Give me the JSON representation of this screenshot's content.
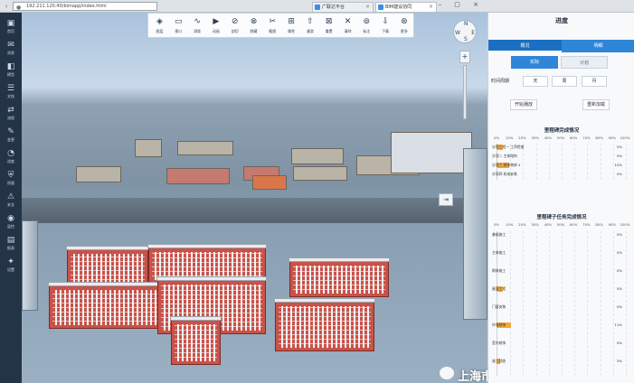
{
  "browser": {
    "address": "192.211.120.40/bimapp/index.html",
    "tabs": [
      {
        "label": "广联达平台"
      },
      {
        "label": "BIM建设协同"
      }
    ]
  },
  "sidebar": {
    "items": [
      {
        "icon": "▣",
        "label": "首页"
      },
      {
        "icon": "✉",
        "label": "消息"
      },
      {
        "icon": "◧",
        "label": "模型"
      },
      {
        "icon": "☰",
        "label": "文档"
      },
      {
        "icon": "⇄",
        "label": "流程"
      },
      {
        "icon": "✎",
        "label": "变更"
      },
      {
        "icon": "◔",
        "label": "进度"
      },
      {
        "icon": "⛨",
        "label": "质量"
      },
      {
        "icon": "⚠",
        "label": "安全"
      },
      {
        "icon": "◉",
        "label": "监控"
      },
      {
        "icon": "▤",
        "label": "报表"
      },
      {
        "icon": "✦",
        "label": "设置"
      }
    ]
  },
  "toolbar": {
    "tools": [
      {
        "icon": "◈",
        "label": "图层"
      },
      {
        "icon": "▭",
        "label": "视口"
      },
      {
        "icon": "∿",
        "label": "测距"
      },
      {
        "icon": "▶",
        "label": "动画"
      },
      {
        "icon": "⊘",
        "label": "剖切"
      },
      {
        "icon": "⊗",
        "label": "隐藏"
      },
      {
        "icon": "✂",
        "label": "截图"
      },
      {
        "icon": "⊞",
        "label": "属性"
      },
      {
        "icon": "⇧",
        "label": "漫游"
      },
      {
        "icon": "⊠",
        "label": "重置"
      },
      {
        "icon": "✕",
        "label": "清除"
      },
      {
        "icon": "⊚",
        "label": "标注"
      },
      {
        "icon": "⇩",
        "label": "下载"
      },
      {
        "icon": "⊛",
        "label": "更多"
      }
    ]
  },
  "viewer": {
    "compass": {
      "n": "N",
      "e": "E",
      "s": "S",
      "w": "W"
    },
    "zoom_in": "+",
    "collapse": "⇥"
  },
  "panel": {
    "title": "进度",
    "tabs": [
      {
        "label": "概况"
      },
      {
        "label": "明细"
      }
    ],
    "toggle_actual": "实际",
    "toggle_plan": "计划",
    "period_label": "时间周期",
    "periods": [
      "天",
      "周",
      "月"
    ],
    "actions": [
      "开始播放",
      "重新加载"
    ],
    "section1_title": "里程碑完成情况",
    "section2_title": "里程碑子任务完成情况",
    "axis_ticks": [
      "0%",
      "10%",
      "20%",
      "30%",
      "40%",
      "50%",
      "60%",
      "70%",
      "80%",
      "90%",
      "100%"
    ],
    "milestones": [
      {
        "label": "分项工程一 工序检查",
        "value": 5,
        "value_text": "5%"
      },
      {
        "label": "分项二 主体结构",
        "value": 0,
        "value_text": "0%"
      },
      {
        "label": "分项三 装饰装修 4",
        "value": 10,
        "value_text": "10%"
      },
      {
        "label": "分项四 机电安装",
        "value": 0,
        "value_text": "0%"
      }
    ],
    "subtasks": [
      {
        "label": "基础施工",
        "value": 0,
        "value_text": "0%"
      },
      {
        "label": "主体施工",
        "value": 0,
        "value_text": "0%"
      },
      {
        "label": "砌体施工",
        "value": 0,
        "value_text": "0%"
      },
      {
        "label": "屋面工程",
        "value": 5,
        "value_text": "5%"
      },
      {
        "label": "门窗安装",
        "value": 0,
        "value_text": "0%"
      },
      {
        "label": "外墙装饰",
        "value": 11,
        "value_text": "11%"
      },
      {
        "label": "室内装饰",
        "value": 0,
        "value_text": "0%"
      },
      {
        "label": "竣工验收",
        "value": 3,
        "value_text": "3%"
      }
    ]
  },
  "watermark": "上海市绿色建筑协会",
  "colors": {
    "accent": "#2f86d8",
    "bar": "#f4a83a",
    "sidebar": "#243447"
  }
}
